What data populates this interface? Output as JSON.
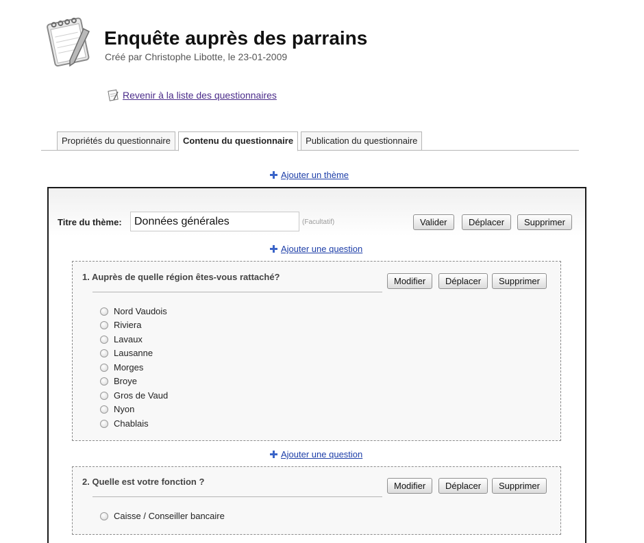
{
  "header": {
    "title": "Enquête auprès des parrains",
    "subtitle": "Créé par Christophe Libotte, le 23-01-2009",
    "back_link": " Revenir à la liste des questionnaires"
  },
  "tabs": [
    {
      "label": "Propriétés du questionnaire",
      "active": false
    },
    {
      "label": "Contenu du questionnaire",
      "active": true
    },
    {
      "label": "Publication du questionnaire",
      "active": false
    }
  ],
  "add_theme_label": "Ajouter un thème",
  "theme": {
    "label": "Titre du thème:",
    "value": "Données générales",
    "hint": "(Facultatif)",
    "buttons": {
      "validate": "Valider",
      "move": "Déplacer",
      "delete": "Supprimer"
    },
    "add_question_label": "Ajouter une question"
  },
  "questions": [
    {
      "title": "1. Auprès de quelle région êtes-vous rattaché?",
      "buttons": {
        "edit": "Modifier",
        "move": "Déplacer",
        "delete": "Supprimer"
      },
      "options": [
        "Nord Vaudois",
        "Riviera",
        "Lavaux",
        "Lausanne",
        "Morges",
        "Broye",
        "Gros de Vaud",
        "Nyon",
        "Chablais"
      ]
    },
    {
      "title": "2. Quelle est votre fonction ?",
      "buttons": {
        "edit": "Modifier",
        "move": "Déplacer",
        "delete": "Supprimer"
      },
      "options": [
        "Caisse / Conseiller bancaire"
      ]
    }
  ],
  "icons": {
    "logo": "notepad-pencil-icon",
    "back": "notepad-icon",
    "add": "plus-icon"
  },
  "colors": {
    "link": "#1d3ea8",
    "visited_link": "#4b2c8a",
    "border": "#1a1a1a"
  }
}
